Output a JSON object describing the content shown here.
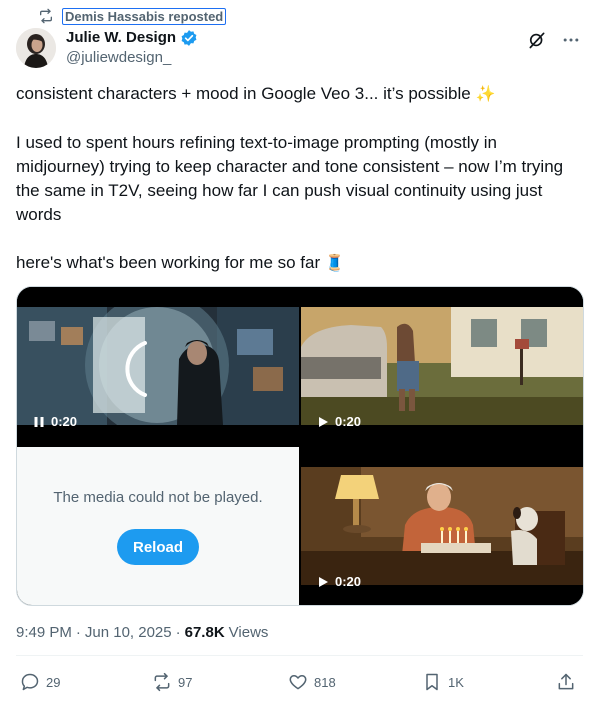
{
  "repost": {
    "label": "Demis Hassabis reposted",
    "icon": "repost-icon"
  },
  "author": {
    "display_name": "Julie W. Design",
    "handle": "@juliewdesign_",
    "verified_color": "#1d9bf0"
  },
  "top_icons": [
    "grok-icon",
    "more-icon"
  ],
  "body": {
    "line1": "consistent characters + mood in Google Veo 3... it’s possible",
    "line1_emoji": "✨",
    "paragraph2": "I used to spent hours refining text-to-image prompting (mostly in midjourney) trying to keep character and tone consistent – now I’m trying the same in T2V, seeing how far I can push visual continuity using just words",
    "line3": "here's what's been working for me so far",
    "line3_emoji": "🧵"
  },
  "media": {
    "video1": {
      "duration": "0:20",
      "state": "pause"
    },
    "video2": {
      "duration": "0:20",
      "state": "play"
    },
    "video3": {
      "error": "The media could not be played.",
      "reload_label": "Reload"
    },
    "video4": {
      "duration": "0:20",
      "state": "play"
    }
  },
  "meta": {
    "time": "9:49 PM",
    "separator": "·",
    "date": "Jun 10, 2025",
    "views_count": "67.8K",
    "views_label": "Views"
  },
  "actions": {
    "replies": "29",
    "reposts": "97",
    "likes": "818",
    "bookmarks": "1K"
  },
  "colors": {
    "accent": "#1d9bf0",
    "text": "#0f1419",
    "muted": "#536471"
  }
}
